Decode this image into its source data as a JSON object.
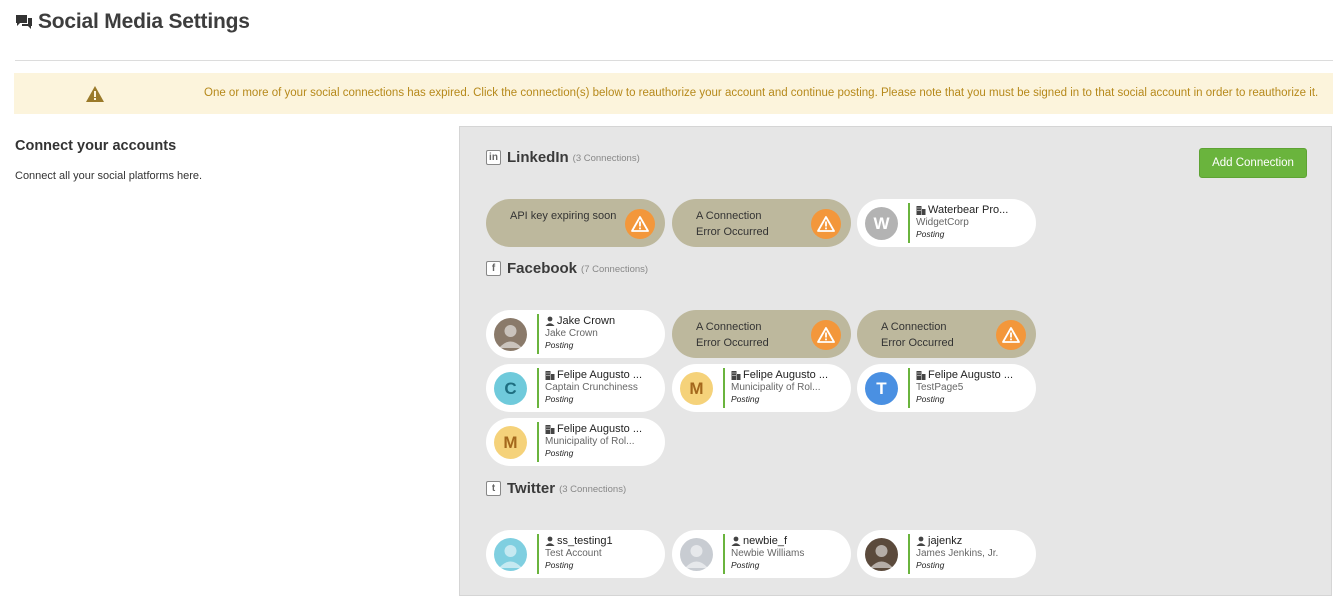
{
  "header": {
    "title": "Social Media Settings",
    "icon": "chat-bubbles-icon"
  },
  "alert": {
    "icon": "warning-icon",
    "message": "One or more of your social connections has expired. Click the connection(s) below to reauthorize your account and continue posting. Please note that you must be signed in to that social account in order to reauthorize it.",
    "color": "#b6891b"
  },
  "left": {
    "title": "Connect your accounts",
    "desc": "Connect all your social platforms here."
  },
  "add_button": {
    "label": "Add Connection",
    "color": "#6ab43d"
  },
  "linkedin": {
    "icon_text": "in",
    "title": "LinkedIn",
    "count": "(3 Connections)",
    "cards": [
      {
        "type": "error",
        "line1": "API key expiring soon",
        "line2": ""
      },
      {
        "type": "error",
        "line1": "A Connection",
        "line2": "Error Occurred"
      },
      {
        "type": "ok",
        "avatar_letter": "W",
        "avatar_color": "#b3b3b3",
        "kind": "company",
        "name": "Waterbear Pro...",
        "sub": "WidgetCorp",
        "role": "Posting"
      }
    ]
  },
  "facebook": {
    "icon_text": "f",
    "title": "Facebook",
    "count": "(7 Connections)",
    "cards": [
      {
        "type": "ok",
        "avatar_letter": "",
        "avatar_color": "#8a7a6a",
        "kind": "person",
        "name": "Jake Crown",
        "sub": "Jake Crown",
        "role": "Posting"
      },
      {
        "type": "error",
        "line1": "A Connection",
        "line2": "Error Occurred"
      },
      {
        "type": "error",
        "line1": "A Connection",
        "line2": "Error Occurred"
      },
      {
        "type": "ok",
        "avatar_letter": "C",
        "avatar_color": "#6fcadb",
        "letter_color": "#1e6e80",
        "kind": "company",
        "name": "Felipe Augusto ...",
        "sub": "Captain Crunchiness",
        "role": "Posting"
      },
      {
        "type": "ok",
        "avatar_letter": "M",
        "avatar_color": "#f5d27a",
        "letter_color": "#a4681c",
        "kind": "company",
        "name": "Felipe Augusto ...",
        "sub": "Municipality of Rol...",
        "role": "Posting"
      },
      {
        "type": "ok",
        "avatar_letter": "T",
        "avatar_color": "#4a90e2",
        "letter_color": "#ffffff",
        "kind": "company",
        "name": "Felipe Augusto ...",
        "sub": "TestPage5",
        "role": "Posting"
      },
      {
        "type": "ok",
        "avatar_letter": "M",
        "avatar_color": "#f5d27a",
        "letter_color": "#a4681c",
        "kind": "company",
        "name": "Felipe Augusto ...",
        "sub": "Municipality of Rol...",
        "role": "Posting"
      }
    ]
  },
  "twitter": {
    "icon_text": "t",
    "title": "Twitter",
    "count": "(3 Connections)",
    "cards": [
      {
        "type": "ok",
        "avatar_letter": "",
        "avatar_color": "#7fcfe0",
        "kind": "person",
        "name": "ss_testing1",
        "sub": "Test Account",
        "role": "Posting"
      },
      {
        "type": "ok",
        "avatar_letter": "",
        "avatar_color": "#c8ccd2",
        "kind": "person",
        "name": "newbie_f",
        "sub": "Newbie Williams",
        "role": "Posting"
      },
      {
        "type": "ok",
        "avatar_letter": "",
        "avatar_color": "#5b4a3c",
        "kind": "person",
        "name": "jajenkz",
        "sub": "James Jenkins, Jr.",
        "role": "Posting"
      }
    ]
  }
}
